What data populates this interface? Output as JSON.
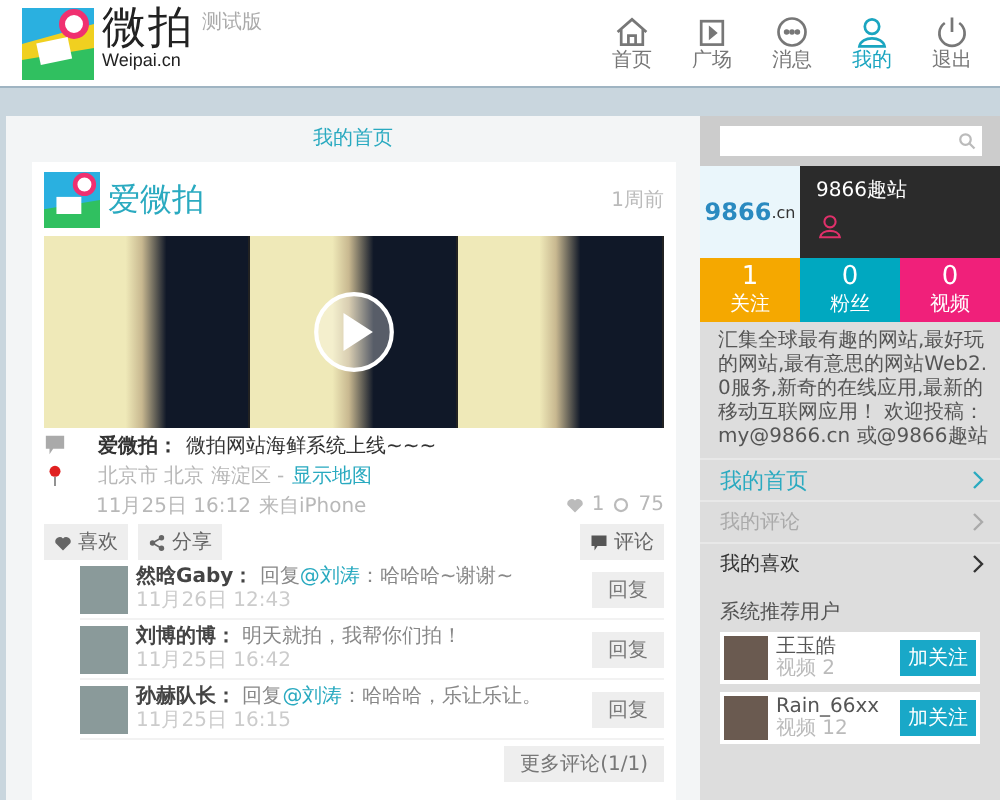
{
  "header": {
    "logo_text": "微拍",
    "logo_sub": "Weipai.cn",
    "badge": "测试版",
    "nav": [
      {
        "label": "首页",
        "selected": false
      },
      {
        "label": "广场",
        "selected": false
      },
      {
        "label": "消息",
        "selected": false
      },
      {
        "label": "我的",
        "selected": true
      },
      {
        "label": "退出",
        "selected": false
      }
    ]
  },
  "main": {
    "title": "我的首页",
    "post": {
      "author": "爱微拍",
      "age": "1周前",
      "author_label": "爱微拍：",
      "text": "微拍网站海鲜系统上线~~~",
      "location": "北京市 北京 海淀区 -",
      "map_link": "显示地图",
      "time": "11月25日 16:12",
      "source": "来自iPhone",
      "likes": "1",
      "views": "75",
      "like_button": "喜欢",
      "share_button": "分享",
      "comment_button": "评论",
      "replies": [
        {
          "name": "然晗Gaby：",
          "reply_to": "@刘涛",
          "text": "：哈哈哈~谢谢~",
          "prefix": "回复",
          "time": "11月26日 12:43",
          "button": "回复"
        },
        {
          "name": "刘博的博：",
          "text": "明天就拍，我帮你们拍！",
          "time": "11月25日 16:42",
          "button": "回复"
        },
        {
          "name": "孙赫队长：",
          "reply_to": "@刘涛",
          "prefix": "回复",
          "text": "：哈哈哈，乐让乐让。",
          "time": "11月25日 16:15",
          "button": "回复"
        }
      ],
      "more": "更多评论(1/1)"
    }
  },
  "sidebar": {
    "site": {
      "logo_number": "9866",
      "logo_suffix": ".cn",
      "name": "9866趣站"
    },
    "stats": [
      {
        "value": "1",
        "label": "关注",
        "color": "#f5a800"
      },
      {
        "value": "0",
        "label": "粉丝",
        "color": "#00a8c0"
      },
      {
        "value": "0",
        "label": "视频",
        "color": "#f0207a"
      }
    ],
    "description": "汇集全球最有趣的网站,最好玩的网站,最有意思的网站Web2.0服务,新奇的在线应用,最新的移动互联网应用！ 欢迎投稿：my@9866.cn 或@9866趣站",
    "menu": [
      {
        "label": "我的首页",
        "selected": true,
        "disabled": false
      },
      {
        "label": "我的评论",
        "selected": false,
        "disabled": true
      },
      {
        "label": "我的喜欢",
        "selected": false,
        "disabled": false
      }
    ],
    "recommend_title": "系统推荐用户",
    "users": [
      {
        "name": "王玉皓",
        "videos": "视频 2",
        "button": "加关注"
      },
      {
        "name": "Rain_66xx",
        "videos": "视频 12",
        "button": "加关注"
      }
    ]
  }
}
